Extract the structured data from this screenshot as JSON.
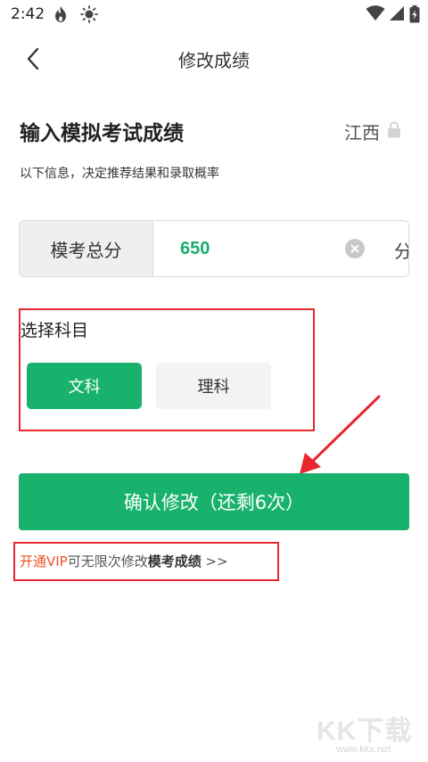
{
  "status_bar": {
    "time": "2:42",
    "left_icons": [
      "flame-icon",
      "sun-icon"
    ],
    "right_icons": [
      "wifi-icon",
      "signal-icon",
      "battery-icon"
    ]
  },
  "nav": {
    "title": "修改成绩",
    "back_icon": "chevron-left-icon"
  },
  "section": {
    "title": "输入模拟考试成绩",
    "province": "江西",
    "province_icon": "lock-icon",
    "subtitle": "以下信息，决定推荐结果和录取概率"
  },
  "score": {
    "label": "模考总分",
    "value": "650",
    "unit": "分",
    "clear_icon": "clear-icon"
  },
  "subject": {
    "title": "选择科目",
    "options": [
      {
        "label": "文科",
        "selected": true
      },
      {
        "label": "理科",
        "selected": false
      }
    ]
  },
  "confirm": {
    "label": "确认修改（还剩6次）"
  },
  "vip": {
    "prefix": "开通VIP",
    "middle": "可无限次修改",
    "bold": "模考成绩",
    "suffix": " >>"
  },
  "watermark": {
    "logo": "KK下载",
    "url": "www.kkx.net"
  },
  "colors": {
    "accent": "#18b26c",
    "score_text": "#1aad6c",
    "annotation_red": "#e8262d",
    "vip_red": "#e8542a"
  }
}
